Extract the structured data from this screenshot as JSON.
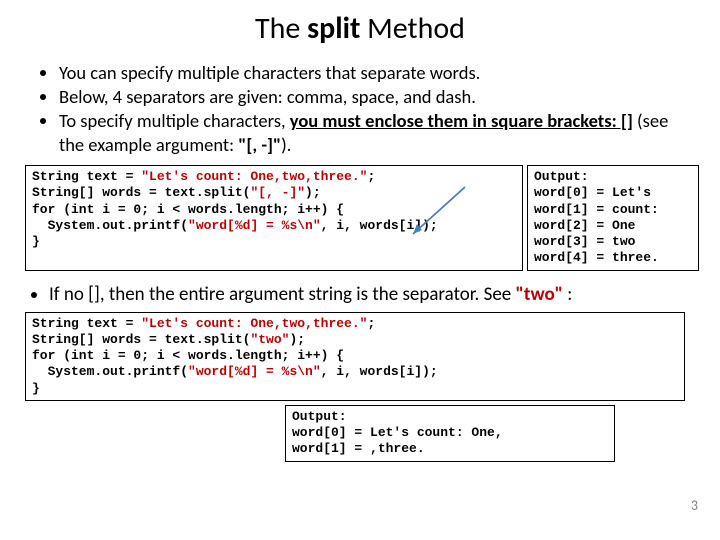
{
  "title": {
    "pre": "The ",
    "bold": "split",
    "post": " Method"
  },
  "bullets1": {
    "b1": "You can specify multiple characters that separate words.",
    "b2": "Below, 4 separators are given:  comma, space, and dash.",
    "b3_pre": "To specify multiple characters, ",
    "b3_u": "you must enclose them in square brackets: []",
    "b3_mid": " (see the example argument: ",
    "b3_arg": "\"[, -]\"",
    "b3_post": ")."
  },
  "code1": {
    "l1a": "String text = ",
    "l1b": "\"Let's count: One,two,three.\"",
    "l1c": ";",
    "l2a": "String[] words = text.split(",
    "l2b": "\"[, -]\"",
    "l2c": ");",
    "l3": "for (int i = 0; i < words.length; i++) {",
    "l4a": "  System.out.printf(",
    "l4b": "\"word[%d] = %s\\n\"",
    "l4c": ", i, words[i]);",
    "l5": "}"
  },
  "out1": {
    "h": "Output:",
    "r0": "word[0] = Let's",
    "r1": "word[1] = count:",
    "r2": "word[2] = One",
    "r3": "word[3] = two",
    "r4": "word[4] = three."
  },
  "bullets2": {
    "b1_pre": "If no [], then the entire argument string is the separator. See ",
    "b1_red": "\"two\"",
    "b1_post": " :"
  },
  "code2": {
    "l1a": "String text = ",
    "l1b": "\"Let's count: One,two,three.\"",
    "l1c": ";",
    "l2a": "String[] words = text.split(",
    "l2b": "\"two\"",
    "l2c": ");",
    "l3": "for (int i = 0; i < words.length; i++) {",
    "l4a": "  System.out.printf(",
    "l4b": "\"word[%d] = %s\\n\"",
    "l4c": ", i, words[i]);",
    "l5": "}"
  },
  "out2": {
    "h": "Output:",
    "r0": "word[0] = Let's count: One,",
    "r1": "word[1] = ,three."
  },
  "page": "3"
}
